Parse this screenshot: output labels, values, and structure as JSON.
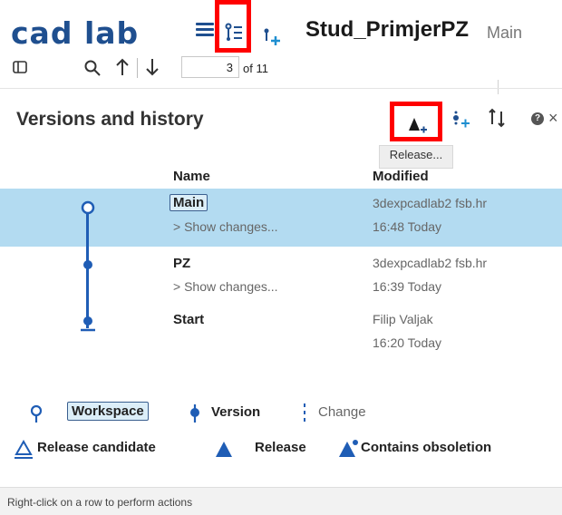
{
  "app": {
    "logo_text": "cad lab",
    "document_title": "Stud_PrimjerPZ",
    "branch": "Main",
    "brand_color": "#1f4f8f"
  },
  "toolbar": {
    "page_value": "3",
    "page_of": "of 11"
  },
  "panel": {
    "title": "Versions and history",
    "tooltip": "Release...",
    "highlight_color": "#ff0000"
  },
  "table": {
    "columns": {
      "name": "Name",
      "modified": "Modified"
    },
    "rows": [
      {
        "name": "Main",
        "changes": "> Show changes...",
        "user": "3dexpcadlab2 fsb.hr",
        "time": "16:48 Today",
        "selected": true
      },
      {
        "name": "PZ",
        "changes": "> Show changes...",
        "user": "3dexpcadlab2 fsb.hr",
        "time": "16:39 Today",
        "selected": false
      },
      {
        "name": "Start",
        "changes": "",
        "user": "Filip Valjak",
        "time": "16:20 Today",
        "selected": false
      }
    ]
  },
  "legend": {
    "workspace": "Workspace",
    "version": "Version",
    "change": "Change",
    "release_candidate": "Release candidate",
    "release": "Release",
    "contains_obsoletion": "Contains obsoletion"
  },
  "footer": {
    "hint": "Right-click on a row to perform actions"
  },
  "colors": {
    "timeline": "#1f5db5",
    "selected_row": "#b3dbf1"
  }
}
